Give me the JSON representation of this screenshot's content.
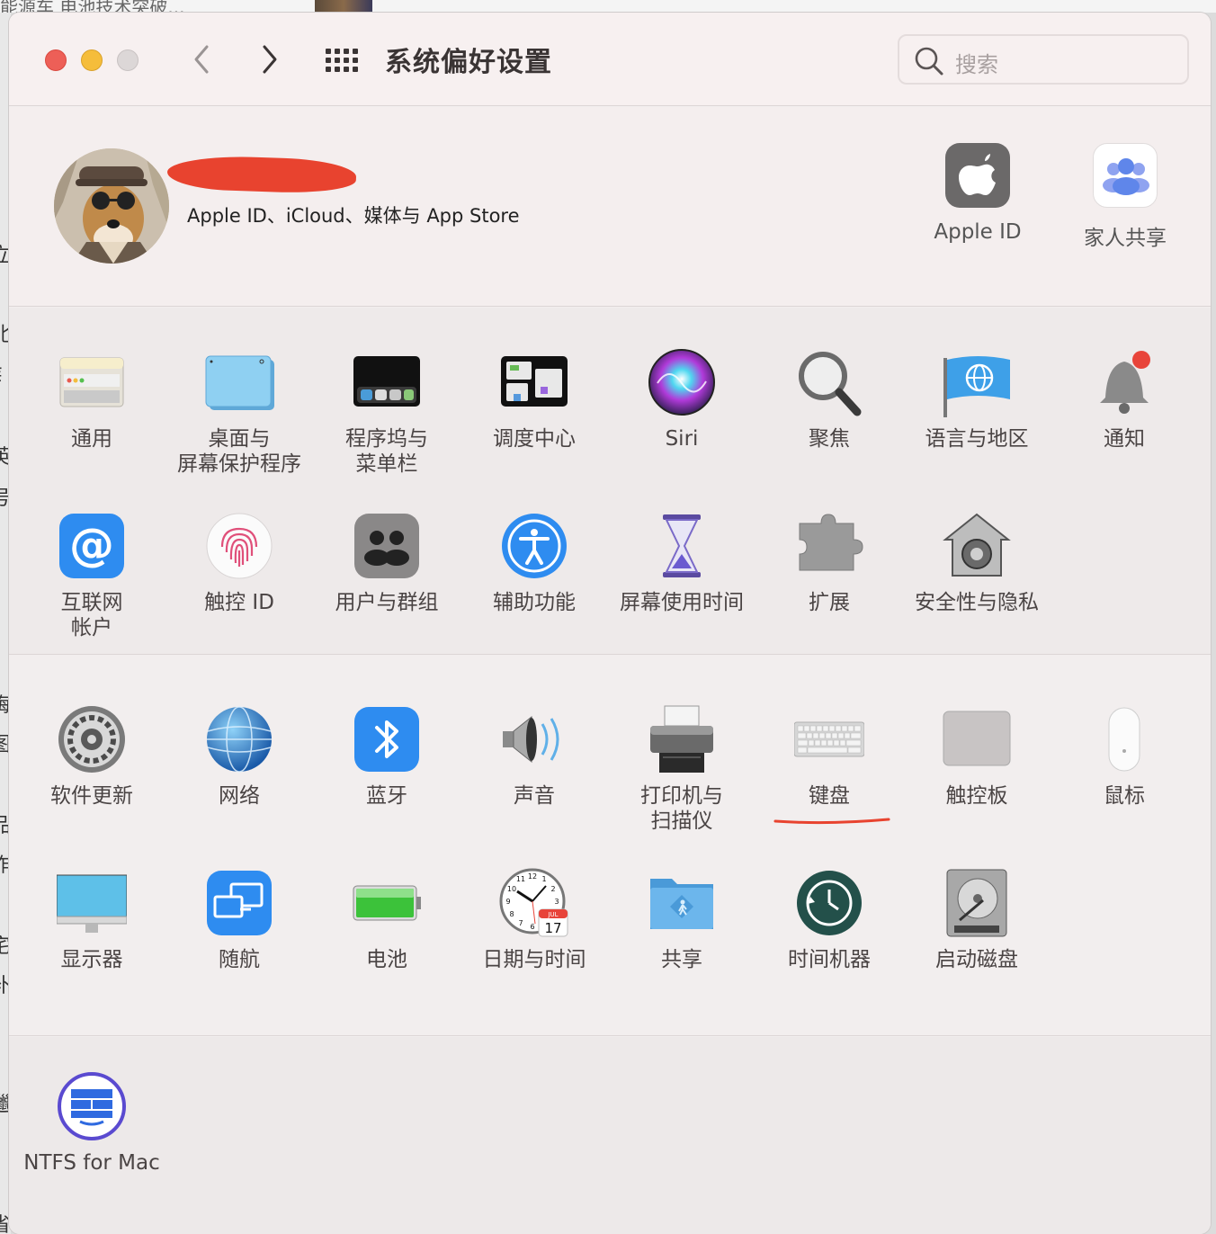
{
  "background": {
    "top_text": "能源车 电池技术突破...",
    "left_chars": [
      "立",
      "北",
      "钅",
      "英",
      "号",
      "梅",
      "图",
      "品",
      "作",
      "宅",
      "补",
      "r",
      "邋",
      "省"
    ]
  },
  "window": {
    "title": "系统偏好设置",
    "search_placeholder": "搜索"
  },
  "account": {
    "subtitle": "Apple ID、iCloud、媒体与 App Store",
    "items": [
      {
        "label": "Apple ID",
        "icon": "apple-logo-icon"
      },
      {
        "label": "家人共享",
        "icon": "family-sharing-icon"
      }
    ]
  },
  "section1": [
    {
      "label": "通用",
      "icon": "general-icon"
    },
    {
      "label": "桌面与\n屏幕保护程序",
      "icon": "desktop-screensaver-icon"
    },
    {
      "label": "程序坞与\n菜单栏",
      "icon": "dock-menubar-icon"
    },
    {
      "label": "调度中心",
      "icon": "mission-control-icon"
    },
    {
      "label": "Siri",
      "icon": "siri-icon"
    },
    {
      "label": "聚焦",
      "icon": "spotlight-icon"
    },
    {
      "label": "语言与地区",
      "icon": "language-region-icon"
    },
    {
      "label": "通知",
      "icon": "notifications-icon"
    },
    {
      "label": "互联网\n帐户",
      "icon": "internet-accounts-icon"
    },
    {
      "label": "触控 ID",
      "icon": "touch-id-icon"
    },
    {
      "label": "用户与群组",
      "icon": "users-groups-icon"
    },
    {
      "label": "辅助功能",
      "icon": "accessibility-icon"
    },
    {
      "label": "屏幕使用时间",
      "icon": "screen-time-icon"
    },
    {
      "label": "扩展",
      "icon": "extensions-icon"
    },
    {
      "label": "安全性与隐私",
      "icon": "security-privacy-icon"
    }
  ],
  "section2": [
    {
      "label": "软件更新",
      "icon": "software-update-icon"
    },
    {
      "label": "网络",
      "icon": "network-icon"
    },
    {
      "label": "蓝牙",
      "icon": "bluetooth-icon"
    },
    {
      "label": "声音",
      "icon": "sound-icon"
    },
    {
      "label": "打印机与\n扫描仪",
      "icon": "printers-scanners-icon"
    },
    {
      "label": "键盘",
      "icon": "keyboard-icon"
    },
    {
      "label": "触控板",
      "icon": "trackpad-icon"
    },
    {
      "label": "鼠标",
      "icon": "mouse-icon"
    },
    {
      "label": "显示器",
      "icon": "displays-icon"
    },
    {
      "label": "随航",
      "icon": "sidecar-icon"
    },
    {
      "label": "电池",
      "icon": "battery-icon"
    },
    {
      "label": "日期与时间",
      "icon": "date-time-icon"
    },
    {
      "label": "共享",
      "icon": "sharing-icon"
    },
    {
      "label": "时间机器",
      "icon": "time-machine-icon"
    },
    {
      "label": "启动磁盘",
      "icon": "startup-disk-icon"
    }
  ],
  "section3": [
    {
      "label": "NTFS for Mac",
      "icon": "ntfs-for-mac-icon"
    }
  ],
  "date_icon": {
    "month": "JUL",
    "day": "17",
    "clock_numbers": [
      "12",
      "11",
      "1",
      "10",
      "2",
      "9",
      "3",
      "8",
      "7",
      "5",
      "6"
    ]
  },
  "colors": {
    "close": "#ed5f57",
    "minimize": "#f5bd3b",
    "zoom_disabled": "#dcd7d7",
    "annotation_red": "#e8432f"
  }
}
